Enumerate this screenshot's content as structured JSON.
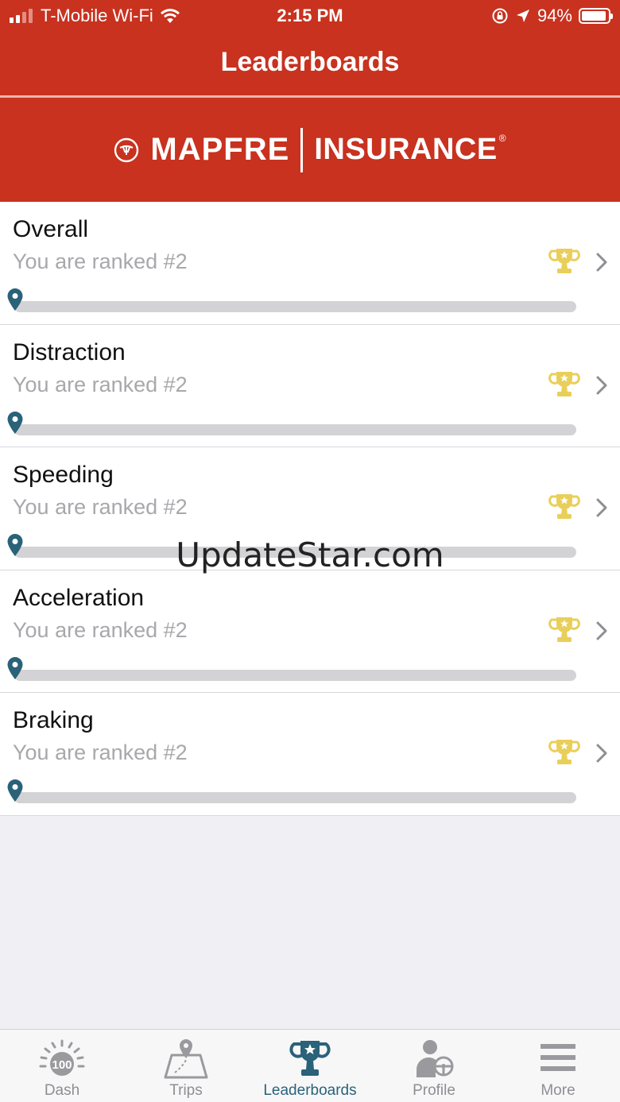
{
  "status": {
    "carrier": "T-Mobile Wi-Fi",
    "time": "2:15 PM",
    "battery": "94%",
    "battery_level": 0.94
  },
  "nav": {
    "title": "Leaderboards"
  },
  "banner": {
    "brand": "MAPFRE",
    "sub": "INSURANCE",
    "reg": "®"
  },
  "leaderboards": [
    {
      "title": "Overall",
      "rank": "You are ranked #2"
    },
    {
      "title": "Distraction",
      "rank": "You are ranked #2"
    },
    {
      "title": "Speeding",
      "rank": "You are ranked #2"
    },
    {
      "title": "Acceleration",
      "rank": "You are ranked #2"
    },
    {
      "title": "Braking",
      "rank": "You are ranked #2"
    }
  ],
  "tabs": [
    {
      "label": "Dash",
      "icon": "speedometer-icon",
      "badge": "100"
    },
    {
      "label": "Trips",
      "icon": "map-route-icon"
    },
    {
      "label": "Leaderboards",
      "icon": "trophy-star-icon",
      "active": true
    },
    {
      "label": "Profile",
      "icon": "driver-profile-icon"
    },
    {
      "label": "More",
      "icon": "menu-icon"
    }
  ],
  "watermark": "UpdateStar.com",
  "colors": {
    "brand": "#c8321f",
    "accent": "#2a6279",
    "trophy": "#e9cf5a"
  }
}
